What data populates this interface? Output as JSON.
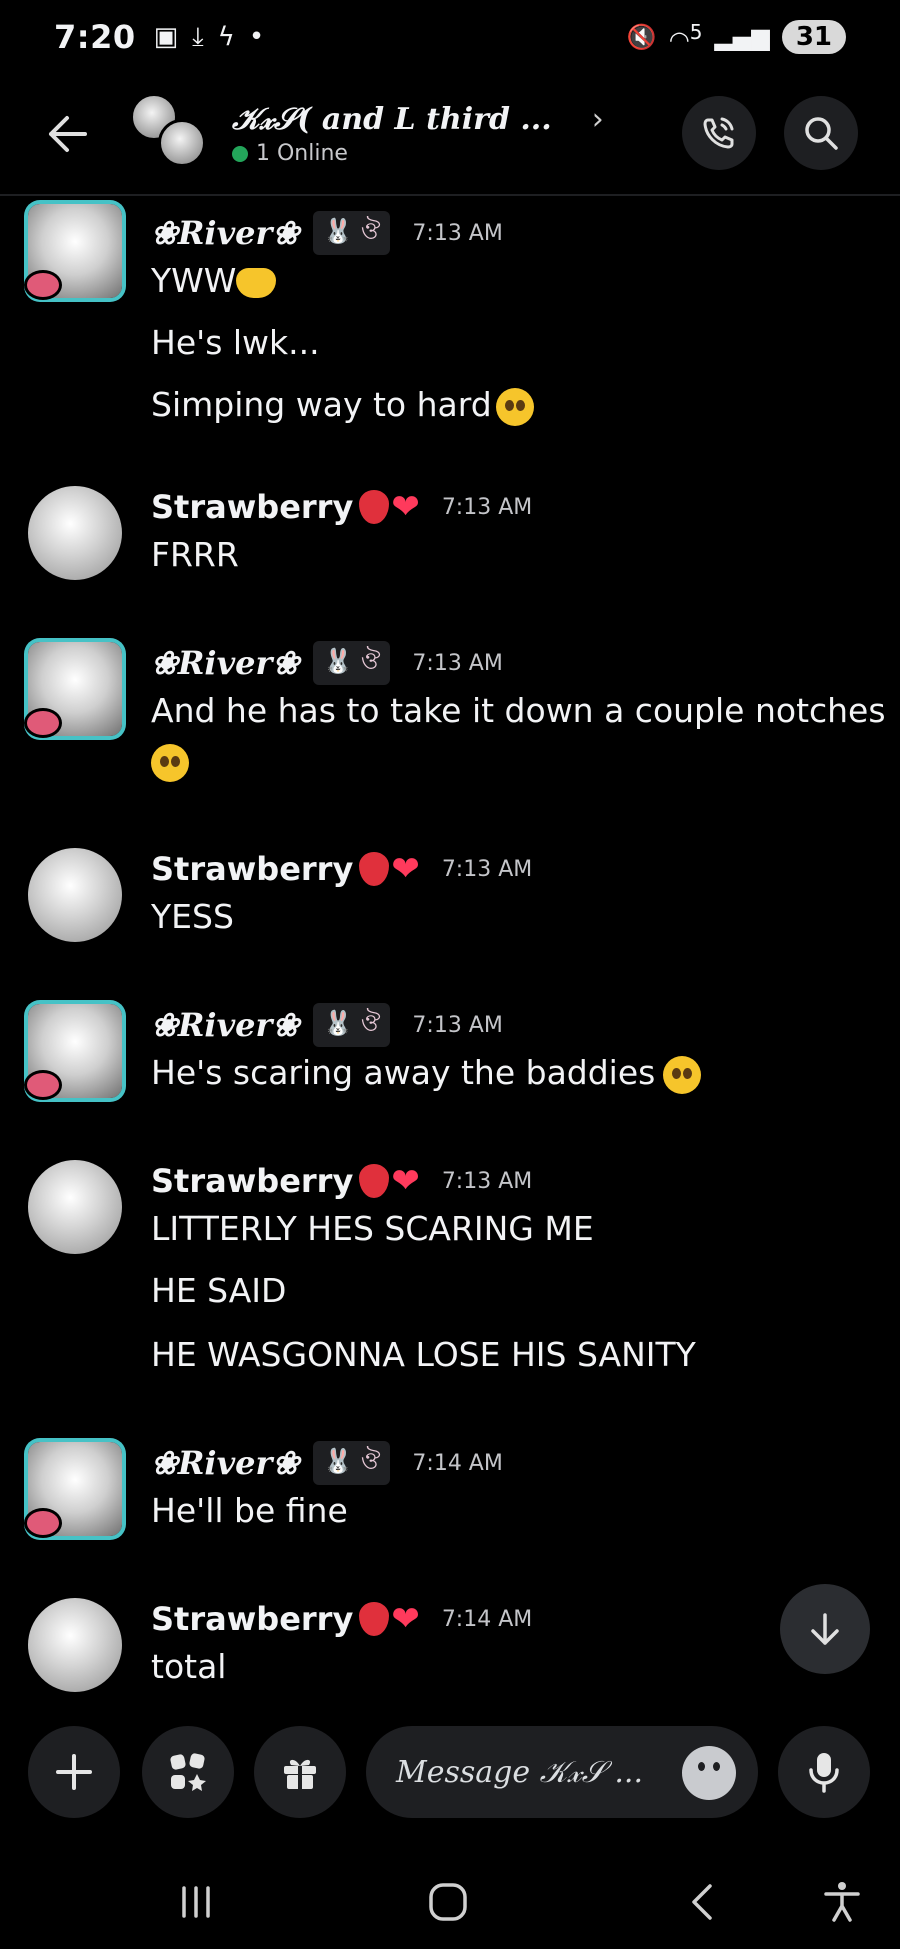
{
  "status_bar": {
    "time": "7:20",
    "signal_label": "5",
    "battery": "31"
  },
  "header": {
    "title": "𝒦𝓍𝒮( and L third ...",
    "online_text": "1 Online"
  },
  "messages": [
    {
      "user": "❀River❀",
      "kind": "river",
      "tag": "🐰 ঔ",
      "time": "7:13 AM",
      "lines": [
        "YWW",
        "He's lwk...",
        "Simping way to hard"
      ]
    },
    {
      "user": "Strawberry",
      "kind": "straw",
      "time": "7:13 AM",
      "lines": [
        "FRRR"
      ]
    },
    {
      "user": "❀River❀",
      "kind": "river",
      "tag": "🐰 ঔ",
      "time": "7:13 AM",
      "lines": [
        "And he has to take it down a couple notches"
      ]
    },
    {
      "user": "Strawberry",
      "kind": "straw",
      "time": "7:13 AM",
      "lines": [
        "YESS"
      ]
    },
    {
      "user": "❀River❀",
      "kind": "river",
      "tag": "🐰 ঔ",
      "time": "7:13 AM",
      "lines": [
        "He's scaring away the baddies"
      ]
    },
    {
      "user": "Strawberry",
      "kind": "straw",
      "time": "7:13 AM",
      "lines": [
        "LITTERLY HES SCARING ME",
        "HE SAID",
        "HE WASGONNA LOSE HIS SANITY"
      ]
    },
    {
      "user": "❀River❀",
      "kind": "river",
      "tag": "🐰 ঔ",
      "time": "7:14 AM",
      "lines": [
        "He'll be fine"
      ]
    },
    {
      "user": "Strawberry",
      "kind": "straw",
      "time": "7:14 AM",
      "lines": [
        "total"
      ]
    }
  ],
  "input": {
    "placeholder": "Message 𝒦𝓍𝒮 ..."
  }
}
